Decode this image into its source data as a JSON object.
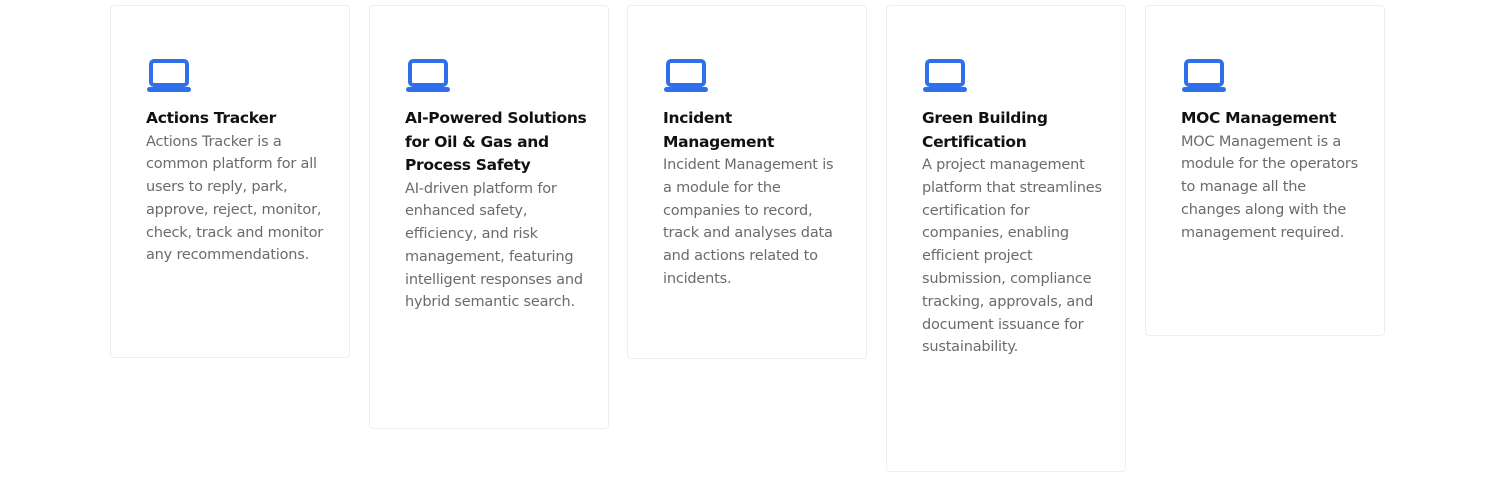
{
  "accent_color": "#2f6fec",
  "cards": [
    {
      "icon": "laptop-icon",
      "title": "Actions Tracker",
      "description": "Actions Tracker is a common platform for all users to reply, park, approve, reject, monitor, check, track and monitor any recommendations."
    },
    {
      "icon": "laptop-icon",
      "title": "AI-Powered Solutions for Oil & Gas and Process Safety",
      "description": "AI-driven platform for enhanced safety, efficiency, and risk management, featuring intelligent responses and hybrid semantic search."
    },
    {
      "icon": "laptop-icon",
      "title": "Incident Management",
      "description": "Incident Management is a module for the companies to record, track and analyses data and actions related to incidents."
    },
    {
      "icon": "laptop-icon",
      "title": "Green Building Certification",
      "description": "A project management platform that streamlines certification for companies, enabling efficient project submission, compliance tracking, approvals, and document issuance for sustainability."
    },
    {
      "icon": "laptop-icon",
      "title": "MOC Management",
      "description": "MOC Management is a module for the operators to manage all the changes along with the management required."
    }
  ]
}
